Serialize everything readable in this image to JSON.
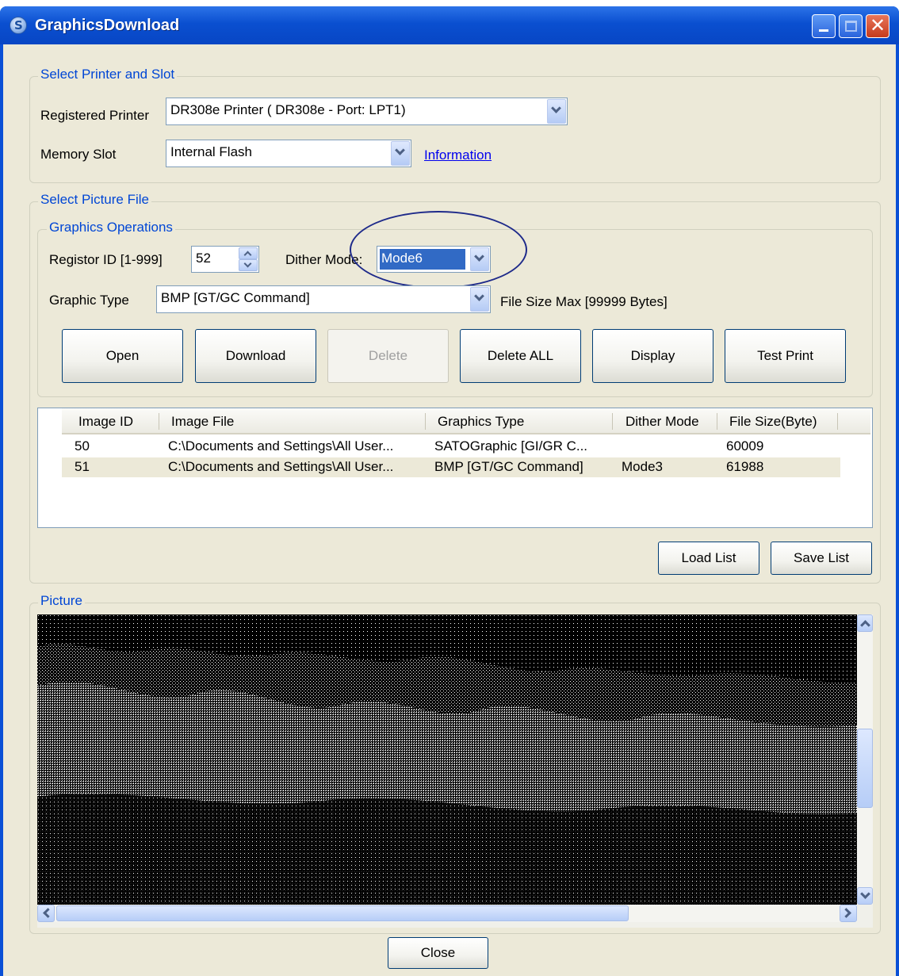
{
  "window": {
    "title": "GraphicsDownload",
    "icon": "sato-logo-icon",
    "controls": [
      "minimize-icon",
      "maximize-icon",
      "close-icon"
    ]
  },
  "printer_group": {
    "legend": "Select Printer and Slot",
    "registered_printer_label": "Registered Printer",
    "registered_printer_value": "DR308e Printer ( DR308e - Port: LPT1)",
    "memory_slot_label": "Memory Slot",
    "memory_slot_value": "Internal Flash",
    "information_link": "Information"
  },
  "picture_file_group": {
    "legend": "Select Picture File",
    "operations": {
      "legend": "Graphics Operations",
      "registor_id_label": "Registor ID [1-999]",
      "registor_id_value": "52",
      "dither_mode_label": "Dither Mode:",
      "dither_mode_value": "Mode6",
      "graphic_type_label": "Graphic Type",
      "graphic_type_value": "BMP [GT/GC Command]",
      "file_size_max": "File Size Max [99999 Bytes]",
      "buttons": {
        "open": "Open",
        "download": "Download",
        "delete": "Delete",
        "delete_all": "Delete ALL",
        "display": "Display",
        "test_print": "Test Print"
      }
    },
    "list": {
      "columns": [
        "Image ID",
        "Image File",
        "Graphics Type",
        "Dither Mode",
        "File Size(Byte)"
      ],
      "rows": [
        {
          "id": "50",
          "file": "C:\\Documents and Settings\\All User...",
          "type": "SATOGraphic [GI/GR C...",
          "dither": "",
          "size": "60009"
        },
        {
          "id": "51",
          "file": "C:\\Documents and Settings\\All User...",
          "type": "BMP [GT/GC Command]",
          "dither": "Mode3",
          "size": "61988"
        }
      ]
    },
    "load_list": "Load List",
    "save_list": "Save List"
  },
  "picture_group": {
    "legend": "Picture",
    "content": "dithered-landscape-image"
  },
  "close_button": "Close",
  "colors": {
    "titlebar": "#0a50d6",
    "legend_text": "#0046d5",
    "window_bg": "#ece9d8",
    "highlight": "#316ac5",
    "annotation_ring": "#1e2a8a"
  }
}
